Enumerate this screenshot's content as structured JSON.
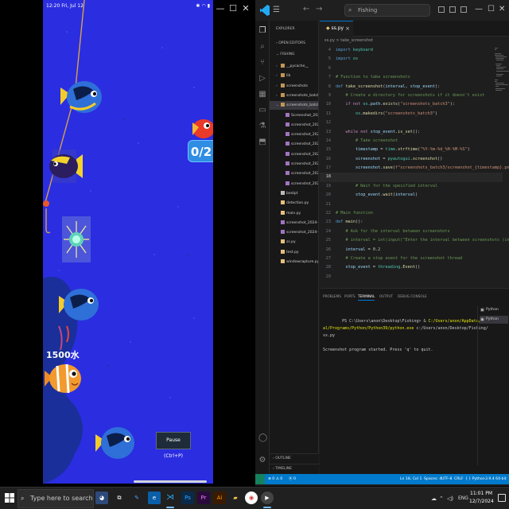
{
  "phone": {
    "status_time": "12:20 Fri, Jul 12",
    "catch_counter": "0/2",
    "score_text": "1500水",
    "pause_tooltip": "Pause (Ctrl+P)"
  },
  "vscode": {
    "search_placeholder": "Fishing",
    "explorer_title": "EXPLORER",
    "open_editors": "OPEN EDITORS",
    "folder": "FISHING",
    "tree": [
      {
        "label": "__pycache__",
        "kind": "folder"
      },
      {
        "label": "lib",
        "kind": "folder"
      },
      {
        "label": "screenshots",
        "kind": "folder"
      },
      {
        "label": "screenshots_batch2",
        "kind": "folder"
      },
      {
        "label": "screenshots_batch3",
        "kind": "folder-open"
      },
      {
        "label": "Screenshot_2024-07...",
        "kind": "img"
      },
      {
        "label": "screenshot_2024-07...",
        "kind": "img"
      },
      {
        "label": "screenshot_2024-07...",
        "kind": "img"
      },
      {
        "label": "screenshot_2024-07...",
        "kind": "img"
      },
      {
        "label": "screenshot_2024-07...",
        "kind": "img"
      },
      {
        "label": "screenshot_2024-07...",
        "kind": "img"
      },
      {
        "label": "screenshot_2024-07...",
        "kind": "img"
      },
      {
        "label": "screenshot_2024-07...",
        "kind": "img"
      },
      {
        "label": "bestpt",
        "kind": "file"
      },
      {
        "label": "detection.py",
        "kind": "py"
      },
      {
        "label": "main.py",
        "kind": "py"
      },
      {
        "label": "screenshot_2024-06-...",
        "kind": "img"
      },
      {
        "label": "screenshot_2024-06-...",
        "kind": "img"
      },
      {
        "label": "ss.py",
        "kind": "py"
      },
      {
        "label": "test.py",
        "kind": "py"
      },
      {
        "label": "windowcapture.py",
        "kind": "py"
      }
    ],
    "outline": "OUTLINE",
    "timeline": "TIMELINE",
    "tab_label": "ss.py",
    "breadcrumb": "ss.py > take_screenshot",
    "line_numbers": [
      "4",
      "5",
      "6",
      "7",
      "8",
      "9",
      "10",
      "11",
      "12",
      "13",
      "14",
      "15",
      "16",
      "17",
      "18",
      "19",
      "20",
      "21",
      "22",
      "23",
      "24",
      "25",
      "26",
      "27",
      "28",
      "29"
    ],
    "code_lines": [
      "import keyboard",
      "import os",
      "",
      "# Function to take screenshots",
      "def take_screenshot(interval, stop_event):",
      "    # Create a directory for screenshots if it doesn't exist",
      "    if not os.path.exists(\"screenshots_batch3\"):",
      "        os.makedirs(\"screenshots_batch3\")",
      "",
      "    while not stop_event.is_set():",
      "        # Take screenshot",
      "        timestamp = time.strftime(\"%Y-%m-%d_%H-%M-%S\")",
      "        screenshot = pyautogui.screenshot()",
      "        screenshot.save(f\"screenshots_batch3/screenshot_{timestamp}.png\")",
      "",
      "        # Wait for the specified interval",
      "        stop_event.wait(interval)",
      "",
      "# Main function",
      "def main():",
      "    # Ask for the interval between screenshots",
      "    # interval = int(input(\"Enter the interval between screenshots (in s",
      "    interval = 0.2",
      "    # Create a stop event for the screenshot thread",
      "    stop_event = threading.Event()",
      ""
    ],
    "panel_tabs": [
      "PROBLEMS",
      "PORTS",
      "TERMINAL",
      "OUTPUT",
      "DEBUG CONSOLE"
    ],
    "terminal_prompt": "PS C:\\Users\\anon\\Desktop\\Fishing> & ",
    "terminal_cmd": "C:/Users/anon/AppData/Local/Programs/Python/Python39/python.exe",
    "terminal_arg": " c:/Users/anon/Desktop/Fishing/ss.py",
    "terminal_output": "Screenshot program started. Press 'q' to quit.",
    "terminal_list": [
      "Python",
      "Python"
    ],
    "status": {
      "errors": "⊗ 0 ⚠ 0",
      "ports": "⦿ 0",
      "position": "Ln 18, Col 1",
      "spaces": "Spaces: 4",
      "encoding": "UTF-8",
      "eol": "CRLF",
      "language": "{ } Python",
      "interpreter": "3.9.4 64-bit"
    }
  },
  "taskbar": {
    "search_placeholder": "Type here to search",
    "lang": "ENG",
    "time": "11:01 PM",
    "date": "12/7/2024"
  },
  "colors": {
    "ocean": "#2b2de0",
    "vscode_accent": "#007acc"
  }
}
